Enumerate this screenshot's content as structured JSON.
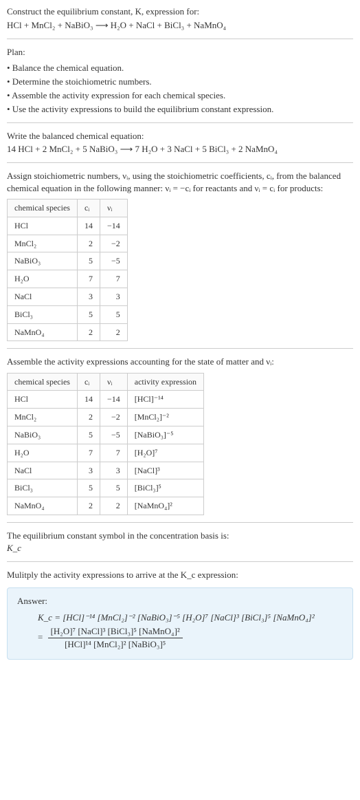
{
  "header": {
    "line1": "Construct the equilibrium constant, K, expression for:",
    "equation": "HCl + MnCl₂ + NaBiO₃ ⟶ H₂O + NaCl + BiCl₃ + NaMnO₄"
  },
  "plan": {
    "title": "Plan:",
    "items": [
      "• Balance the chemical equation.",
      "• Determine the stoichiometric numbers.",
      "• Assemble the activity expression for each chemical species.",
      "• Use the activity expressions to build the equilibrium constant expression."
    ]
  },
  "balanced": {
    "title": "Write the balanced chemical equation:",
    "equation": "14 HCl + 2 MnCl₂ + 5 NaBiO₃ ⟶ 7 H₂O + 3 NaCl + 5 BiCl₃ + 2 NaMnO₄"
  },
  "stoich": {
    "intro": "Assign stoichiometric numbers, νᵢ, using the stoichiometric coefficients, cᵢ, from the balanced chemical equation in the following manner: νᵢ = −cᵢ for reactants and νᵢ = cᵢ for products:",
    "headers": {
      "species": "chemical species",
      "ci": "cᵢ",
      "vi": "νᵢ"
    },
    "rows": [
      {
        "species": "HCl",
        "ci": "14",
        "vi": "−14"
      },
      {
        "species": "MnCl₂",
        "ci": "2",
        "vi": "−2"
      },
      {
        "species": "NaBiO₃",
        "ci": "5",
        "vi": "−5"
      },
      {
        "species": "H₂O",
        "ci": "7",
        "vi": "7"
      },
      {
        "species": "NaCl",
        "ci": "3",
        "vi": "3"
      },
      {
        "species": "BiCl₃",
        "ci": "5",
        "vi": "5"
      },
      {
        "species": "NaMnO₄",
        "ci": "2",
        "vi": "2"
      }
    ]
  },
  "activity": {
    "intro": "Assemble the activity expressions accounting for the state of matter and νᵢ:",
    "headers": {
      "species": "chemical species",
      "ci": "cᵢ",
      "vi": "νᵢ",
      "expr": "activity expression"
    },
    "rows": [
      {
        "species": "HCl",
        "ci": "14",
        "vi": "−14",
        "expr": "[HCl]⁻¹⁴"
      },
      {
        "species": "MnCl₂",
        "ci": "2",
        "vi": "−2",
        "expr": "[MnCl₂]⁻²"
      },
      {
        "species": "NaBiO₃",
        "ci": "5",
        "vi": "−5",
        "expr": "[NaBiO₃]⁻⁵"
      },
      {
        "species": "H₂O",
        "ci": "7",
        "vi": "7",
        "expr": "[H₂O]⁷"
      },
      {
        "species": "NaCl",
        "ci": "3",
        "vi": "3",
        "expr": "[NaCl]³"
      },
      {
        "species": "BiCl₃",
        "ci": "5",
        "vi": "5",
        "expr": "[BiCl₃]⁵"
      },
      {
        "species": "NaMnO₄",
        "ci": "2",
        "vi": "2",
        "expr": "[NaMnO₄]²"
      }
    ]
  },
  "kc_symbol": {
    "line1": "The equilibrium constant symbol in the concentration basis is:",
    "line2": "K_c"
  },
  "multiply": "Mulitply the activity expressions to arrive at the K_c expression:",
  "answer": {
    "label": "Answer:",
    "line1": "K_c = [HCl]⁻¹⁴ [MnCl₂]⁻² [NaBiO₃]⁻⁵ [H₂O]⁷ [NaCl]³ [BiCl₃]⁵ [NaMnO₄]²",
    "eq_prefix": "= ",
    "numerator": "[H₂O]⁷ [NaCl]³ [BiCl₃]⁵ [NaMnO₄]²",
    "denominator": "[HCl]¹⁴ [MnCl₂]² [NaBiO₃]⁵"
  }
}
